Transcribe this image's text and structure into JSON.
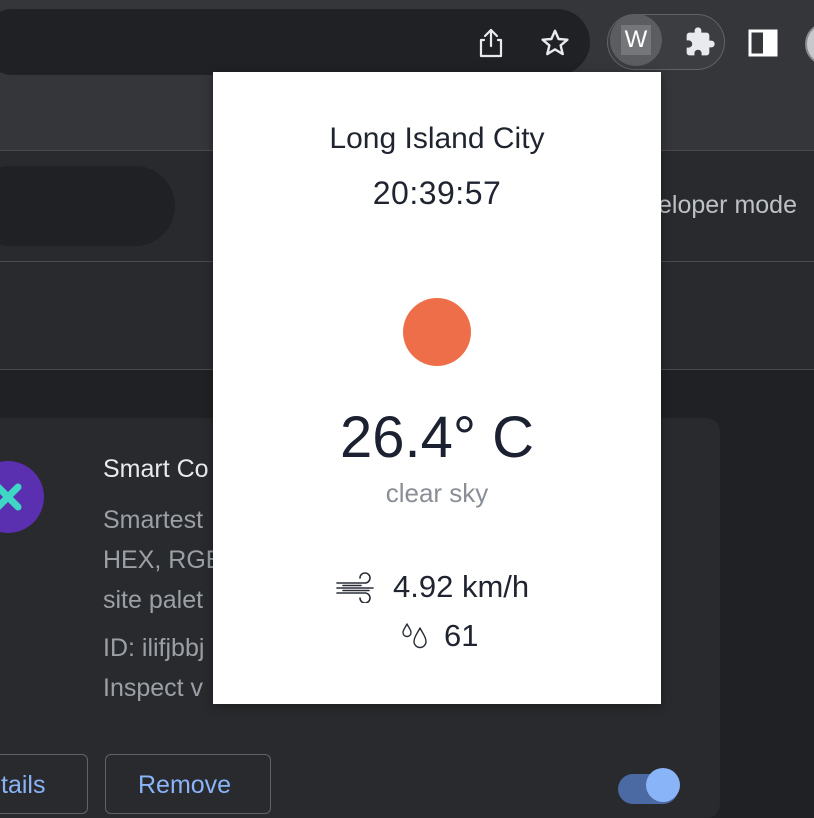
{
  "extensions_page": {
    "developer_mode_label": "eloper mode",
    "card": {
      "title": "Smart Co",
      "description_lines": [
        "Smartest",
        "HEX, RGB",
        "site palet"
      ],
      "id_label": "ID: ilifjbbj",
      "inspect_label": "Inspect v",
      "details_label": "tails",
      "remove_label": "Remove",
      "enabled": true
    }
  },
  "toolbar": {
    "extension_badge": "W"
  },
  "weather_popup": {
    "city": "Long Island City",
    "time": "20:39:57",
    "temperature": "26.4° C",
    "condition": "clear sky",
    "wind_speed": "4.92 km/h",
    "humidity": "61",
    "sun_color": "#ee6e4a",
    "condition_icon": "sun-icon",
    "wind_icon": "wind-icon",
    "humidity_icon": "water-drops-icon"
  }
}
